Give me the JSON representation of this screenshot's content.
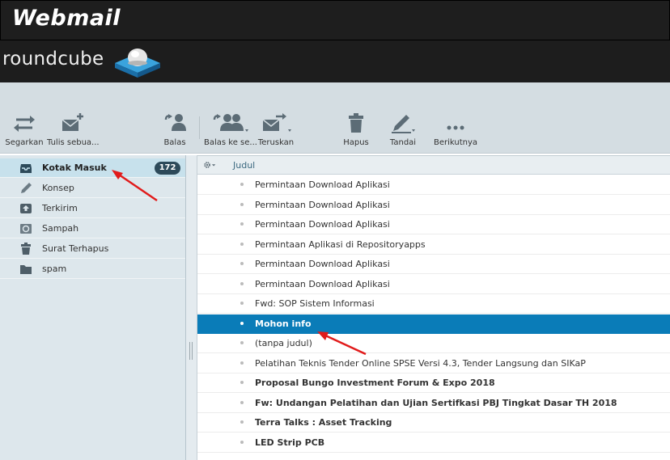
{
  "app": {
    "banner_title": "Webmail",
    "logo_text": "roundcube"
  },
  "toolbar": {
    "refresh": "Segarkan",
    "compose": "Tulis sebua...",
    "reply": "Balas",
    "reply_all": "Balas ke se...",
    "forward": "Teruskan",
    "delete": "Hapus",
    "mark": "Tandai",
    "more": "Berikutnya"
  },
  "folders": [
    {
      "label": "Kotak Masuk",
      "icon": "inbox-icon",
      "count": "172",
      "selected": true
    },
    {
      "label": "Konsep",
      "icon": "pencil-icon"
    },
    {
      "label": "Terkirim",
      "icon": "sent-icon"
    },
    {
      "label": "Sampah",
      "icon": "junk-icon"
    },
    {
      "label": "Surat Terhapus",
      "icon": "trash-icon"
    },
    {
      "label": "spam",
      "icon": "folder-icon"
    }
  ],
  "list": {
    "column": "Judul",
    "messages": [
      {
        "subject": "Permintaan Download Aplikasi",
        "state": "read"
      },
      {
        "subject": "Permintaan Download Aplikasi",
        "state": "read"
      },
      {
        "subject": "Permintaan Download Aplikasi",
        "state": "read"
      },
      {
        "subject": "Permintaan Aplikasi di Repositoryapps",
        "state": "read"
      },
      {
        "subject": "Permintaan Download Aplikasi",
        "state": "read"
      },
      {
        "subject": "Permintaan Download Aplikasi",
        "state": "read"
      },
      {
        "subject": "Fwd: SOP Sistem Informasi",
        "state": "read"
      },
      {
        "subject": "Mohon info",
        "state": "selected"
      },
      {
        "subject": "(tanpa judul)",
        "state": "read"
      },
      {
        "subject": "Pelatihan Teknis Tender Online SPSE Versi 4.3, Tender Langsung dan SIKaP",
        "state": "read"
      },
      {
        "subject": "Proposal Bungo Investment Forum & Expo 2018",
        "state": "unread"
      },
      {
        "subject": "Fw: Undangan Pelatihan dan Ujian Sertifkasi PBJ Tingkat Dasar TH 2018",
        "state": "unread"
      },
      {
        "subject": "Terra Talks : Asset Tracking",
        "state": "unread"
      },
      {
        "subject": "LED Strip PCB",
        "state": "unread"
      }
    ]
  },
  "colors": {
    "accent": "#0a7cb8",
    "annotation": "#e11b1b",
    "badge": "#2d4a5a"
  }
}
